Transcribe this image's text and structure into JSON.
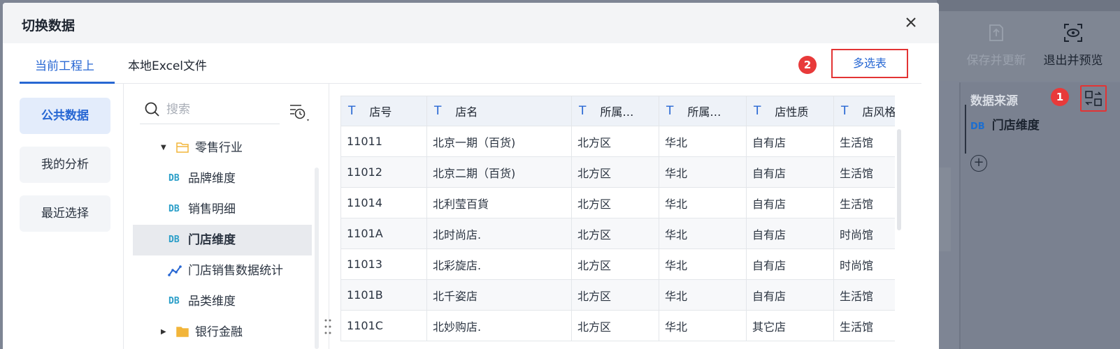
{
  "background": {
    "save_label": "保存并更新",
    "exit_label": "退出并预览",
    "panel_title": "数据来源",
    "source_tag": "DB",
    "source_name": "门店维度",
    "badge1": "1"
  },
  "dialog": {
    "title": "切换数据",
    "tabs": [
      {
        "label": "当前工程上",
        "active": true
      },
      {
        "label": "本地Excel文件",
        "active": false
      }
    ],
    "badge2": "2",
    "multi_select_label": "多选表",
    "categories": [
      {
        "label": "公共数据",
        "active": true
      },
      {
        "label": "我的分析",
        "active": false
      },
      {
        "label": "最近选择",
        "active": false
      }
    ],
    "search": {
      "placeholder": "搜索"
    },
    "tree": [
      {
        "type": "folder",
        "expanded": true,
        "label": "零售行业"
      },
      {
        "type": "db",
        "tag": "DB",
        "label": "品牌维度"
      },
      {
        "type": "db",
        "tag": "DB",
        "label": "销售明细"
      },
      {
        "type": "db",
        "tag": "DB",
        "label": "门店维度",
        "selected": true
      },
      {
        "type": "analysis",
        "label": "门店销售数据统计"
      },
      {
        "type": "db",
        "tag": "DB",
        "label": "品类维度"
      },
      {
        "type": "folder",
        "expanded": false,
        "label": "银行金融"
      }
    ],
    "table": {
      "type_icon": "T",
      "columns": [
        "店号",
        "店名",
        "所属…",
        "所属…",
        "店性质",
        "店风格"
      ],
      "rows": [
        [
          "11011",
          "北京一期（百货)",
          "北方区",
          "华北",
          "自有店",
          "生活馆"
        ],
        [
          "11012",
          "北京二期（百货)",
          "北方区",
          "华北",
          "自有店",
          "生活馆"
        ],
        [
          "11014",
          "北利莹百貨",
          "北方区",
          "华北",
          "自有店",
          "生活馆"
        ],
        [
          "1101A",
          "北时尚店.",
          "北方区",
          "华北",
          "自有店",
          "时尚馆"
        ],
        [
          "11013",
          "北彩旋店.",
          "北方区",
          "华北",
          "自有店",
          "时尚馆"
        ],
        [
          "1101B",
          "北千姿店",
          "北方区",
          "华北",
          "自有店",
          "生活馆"
        ],
        [
          "1101C",
          "北妙购店.",
          "北方区",
          "华北",
          "其它店",
          "生活馆"
        ]
      ]
    }
  },
  "colors": {
    "accent": "#2767d3",
    "highlight_red": "#e33434",
    "badge_red": "#e83a3a",
    "db_tag": "#2a9ec8",
    "folder": "#f2b53a"
  }
}
